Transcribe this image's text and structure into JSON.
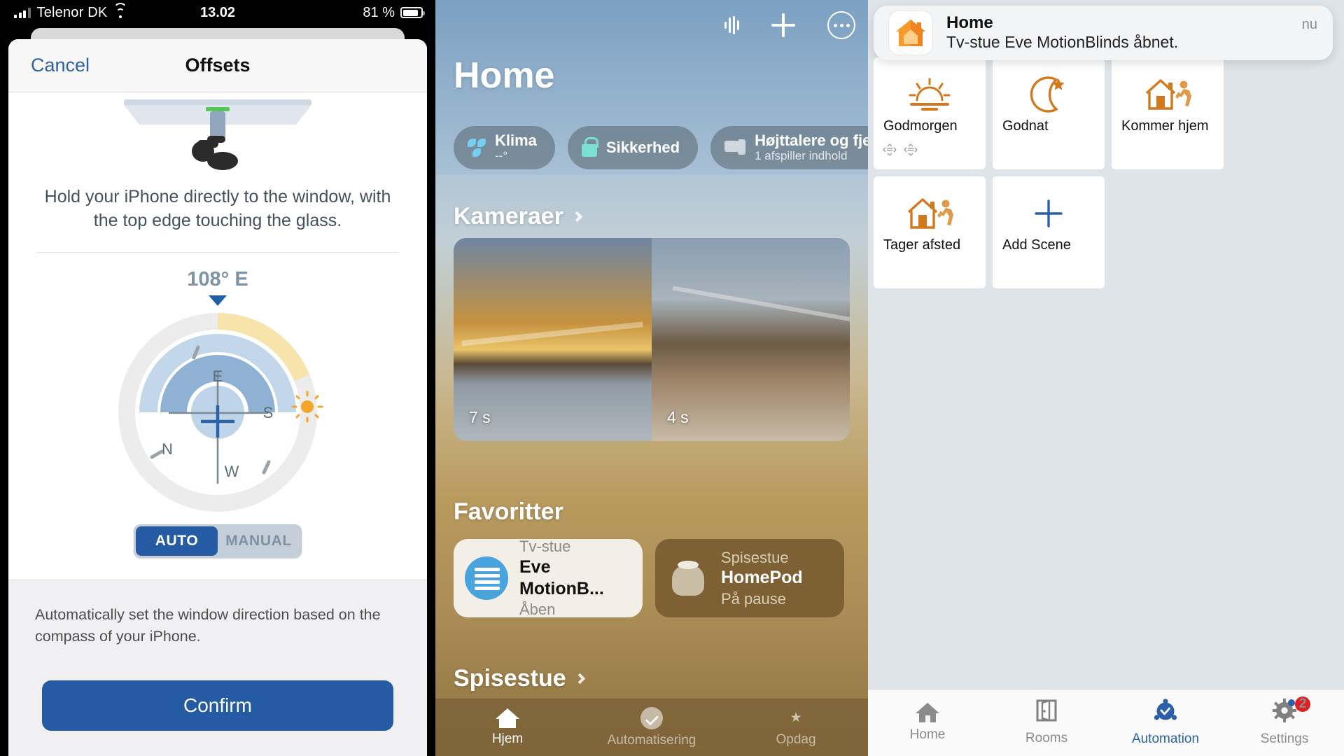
{
  "panel1": {
    "status_bar": {
      "carrier": "Telenor DK",
      "time": "13.02",
      "battery": "81 %",
      "signal_icon": "cellular-signal-icon",
      "wifi_icon": "wifi-icon",
      "battery_icon": "battery-icon"
    },
    "nav": {
      "cancel": "Cancel",
      "title": "Offsets"
    },
    "instruction": "Hold your iPhone directly to the window, with the top edge touching the glass.",
    "heading_value": "108° E",
    "compass": {
      "cardinals": [
        "E",
        "S",
        "N",
        "W"
      ],
      "sun_icon": "sun-icon",
      "pointer_icon": "caret-down-icon",
      "crosshair_icon": "crosshair-icon"
    },
    "toggle": {
      "auto": "AUTO",
      "manual": "MANUAL",
      "selected": "AUTO"
    },
    "footer_text": "Automatically set the window direction based on the compass of your iPhone.",
    "confirm": "Confirm"
  },
  "panel2": {
    "title": "Home",
    "top_icons": [
      "waveform-icon",
      "plus-icon",
      "more-ellipsis-icon"
    ],
    "pills": [
      {
        "label": "Klima",
        "sub": "--°",
        "icon": "fan-icon"
      },
      {
        "label": "Sikkerhed",
        "sub": "",
        "icon": "lock-icon"
      },
      {
        "label": "Højttalere og fjernsyn",
        "sub": "1 afspiller indhold",
        "icon": "speaker-tv-icon"
      }
    ],
    "sections": {
      "cameras": "Kameraer",
      "favorites": "Favoritter",
      "room": "Spisestue"
    },
    "cameras": [
      {
        "time": "7 s"
      },
      {
        "time": "4 s"
      }
    ],
    "favorites": [
      {
        "room": "Tv-stue",
        "name": "Eve MotionB...",
        "state": "Åben",
        "icon": "blinds-icon"
      },
      {
        "room": "Spisestue",
        "name": "HomePod",
        "state": "På pause",
        "icon": "homepod-icon"
      }
    ],
    "tabs": [
      {
        "label": "Hjem",
        "icon": "house-icon",
        "active": true
      },
      {
        "label": "Automatisering",
        "icon": "clock-check-icon",
        "active": false
      },
      {
        "label": "Opdag",
        "icon": "star-icon",
        "active": false
      }
    ]
  },
  "panel3": {
    "notification": {
      "app": "Home",
      "message": "Tv-stue Eve MotionBlinds åbnet.",
      "time": "nu",
      "icon": "home-app-icon"
    },
    "scenes": [
      {
        "label": "Godmorgen",
        "icon": "sunrise-icon",
        "has_handles": true
      },
      {
        "label": "Godnat",
        "icon": "moon-star-icon",
        "has_handles": false
      },
      {
        "label": "Kommer hjem",
        "icon": "house-arriving-icon",
        "has_handles": false
      },
      {
        "label": "Tager afsted",
        "icon": "house-leaving-icon",
        "has_handles": false
      },
      {
        "label": "Add Scene",
        "icon": "plus-icon",
        "has_handles": false
      }
    ],
    "tabs": [
      {
        "label": "Home",
        "icon": "house-icon",
        "active": false,
        "badge": ""
      },
      {
        "label": "Rooms",
        "icon": "door-icon",
        "active": false,
        "badge": ""
      },
      {
        "label": "Automation",
        "icon": "automation-icon",
        "active": true,
        "badge": ""
      },
      {
        "label": "Settings",
        "icon": "gear-icon",
        "active": false,
        "badge": "2"
      }
    ]
  },
  "colors": {
    "accent_blue": "#255ba3",
    "eve_orange": "#d2791e",
    "badge_red": "#e02020",
    "home_tab_active": "#2b60a8"
  }
}
